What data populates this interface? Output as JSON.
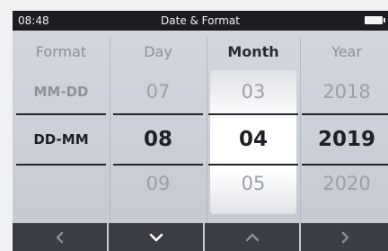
{
  "status_bar": {
    "time": "08:48",
    "title": "Date & Format",
    "battery_icon": "battery-full-icon"
  },
  "columns": {
    "format": {
      "header": "Format",
      "above": "MM-DD",
      "selected": "DD-MM"
    },
    "day": {
      "header": "Day",
      "above": "07",
      "selected": "08",
      "below": "09"
    },
    "month": {
      "header": "Month",
      "above": "03",
      "selected": "04",
      "below": "05"
    },
    "year": {
      "header": "Year",
      "above": "2018",
      "selected": "2019",
      "below": "2020"
    }
  },
  "active_column": "month",
  "nav_buttons": [
    {
      "icon": "chevron-left-icon",
      "active": false
    },
    {
      "icon": "chevron-down-icon",
      "active": true
    },
    {
      "icon": "chevron-up-icon",
      "active": false
    },
    {
      "icon": "chevron-right-icon",
      "active": false
    }
  ],
  "colors": {
    "status_bar": "#1b1d22",
    "nav_button": "#3a3d43",
    "nav_icon_active": "#ffffff",
    "nav_icon_inactive": "#8a8e96",
    "screen_background": "#cbd0d7"
  }
}
